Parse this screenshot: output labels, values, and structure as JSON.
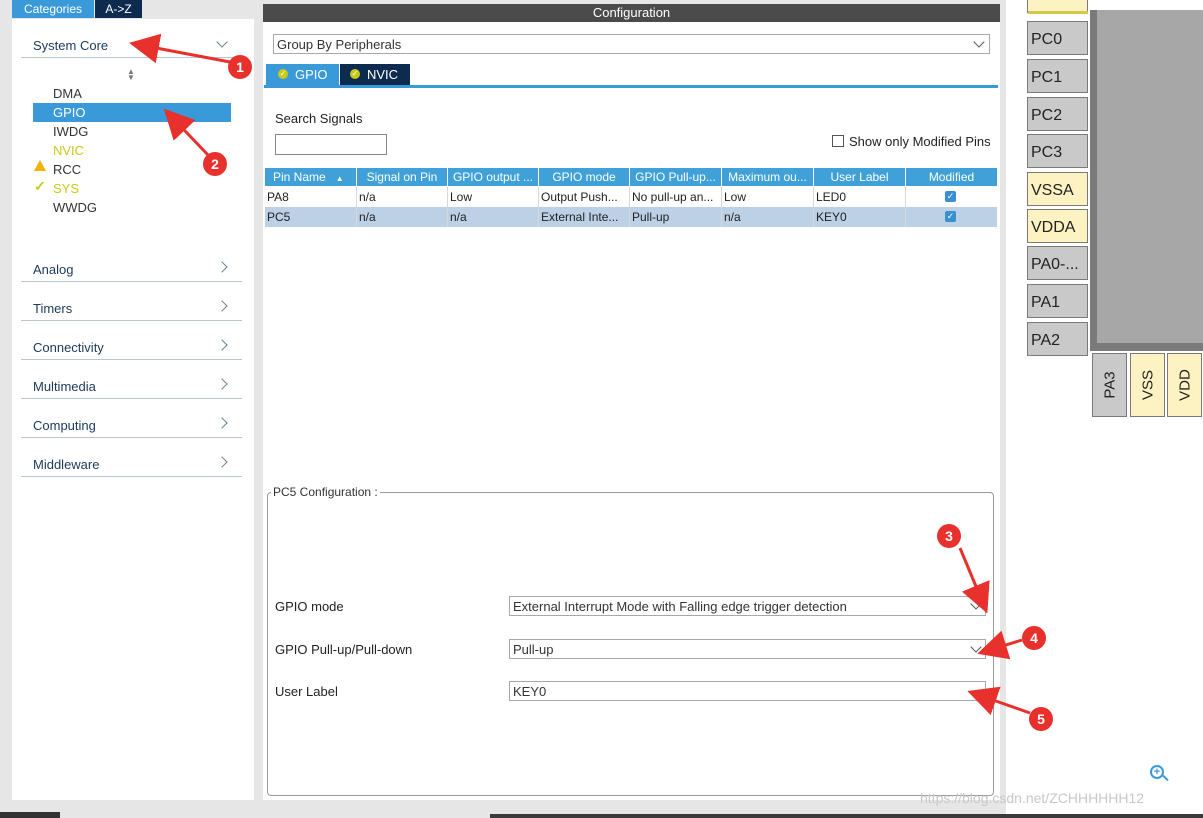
{
  "tabs": {
    "categories": "Categories",
    "az": "A->Z"
  },
  "sidebar": {
    "system_core": "System Core",
    "sub_items": [
      "DMA",
      "GPIO",
      "IWDG",
      "NVIC",
      "RCC",
      "SYS",
      "WWDG"
    ],
    "categories": [
      "Analog",
      "Timers",
      "Connectivity",
      "Multimedia",
      "Computing",
      "Middleware"
    ]
  },
  "config": {
    "title": "Configuration",
    "group_by": "Group By Peripherals",
    "tab_gpio": "GPIO",
    "tab_nvic": "NVIC",
    "search_label": "Search Signals",
    "search_value": "",
    "show_modified": "Show only Modified Pins"
  },
  "table": {
    "headers": [
      "Pin Name",
      "Signal on Pin",
      "GPIO output ...",
      "GPIO mode",
      "GPIO Pull-up...",
      "Maximum ou...",
      "User Label",
      "Modified"
    ],
    "rows": [
      [
        "PA8",
        "n/a",
        "Low",
        "Output Push...",
        "No pull-up an...",
        "Low",
        "LED0"
      ],
      [
        "PC5",
        "n/a",
        "n/a",
        "External Inte...",
        "Pull-up",
        "n/a",
        "KEY0"
      ]
    ]
  },
  "pc5": {
    "legend": "PC5 Configuration :",
    "gpio_mode_label": "GPIO mode",
    "gpio_mode_value": "External Interrupt Mode with Falling edge trigger detection",
    "pull_label": "GPIO Pull-up/Pull-down",
    "pull_value": "Pull-up",
    "user_label": "User Label",
    "user_value": "KEY0"
  },
  "pins": [
    "PC0",
    "PC1",
    "PC2",
    "PC3",
    "VSSA",
    "VDDA",
    "PA0-...",
    "PA1",
    "PA2"
  ],
  "bottom_pins": [
    "PA3",
    "VSS",
    "VDD"
  ],
  "annotations": [
    "1",
    "2",
    "3",
    "4",
    "5"
  ],
  "watermark": "https://blog.csdn.net/ZCHHHHHH12",
  "colors": {
    "accent": "#3fa1d8",
    "selected": "#3a9ad9",
    "annotation": "#e8302c",
    "ok": "#c9c918"
  }
}
